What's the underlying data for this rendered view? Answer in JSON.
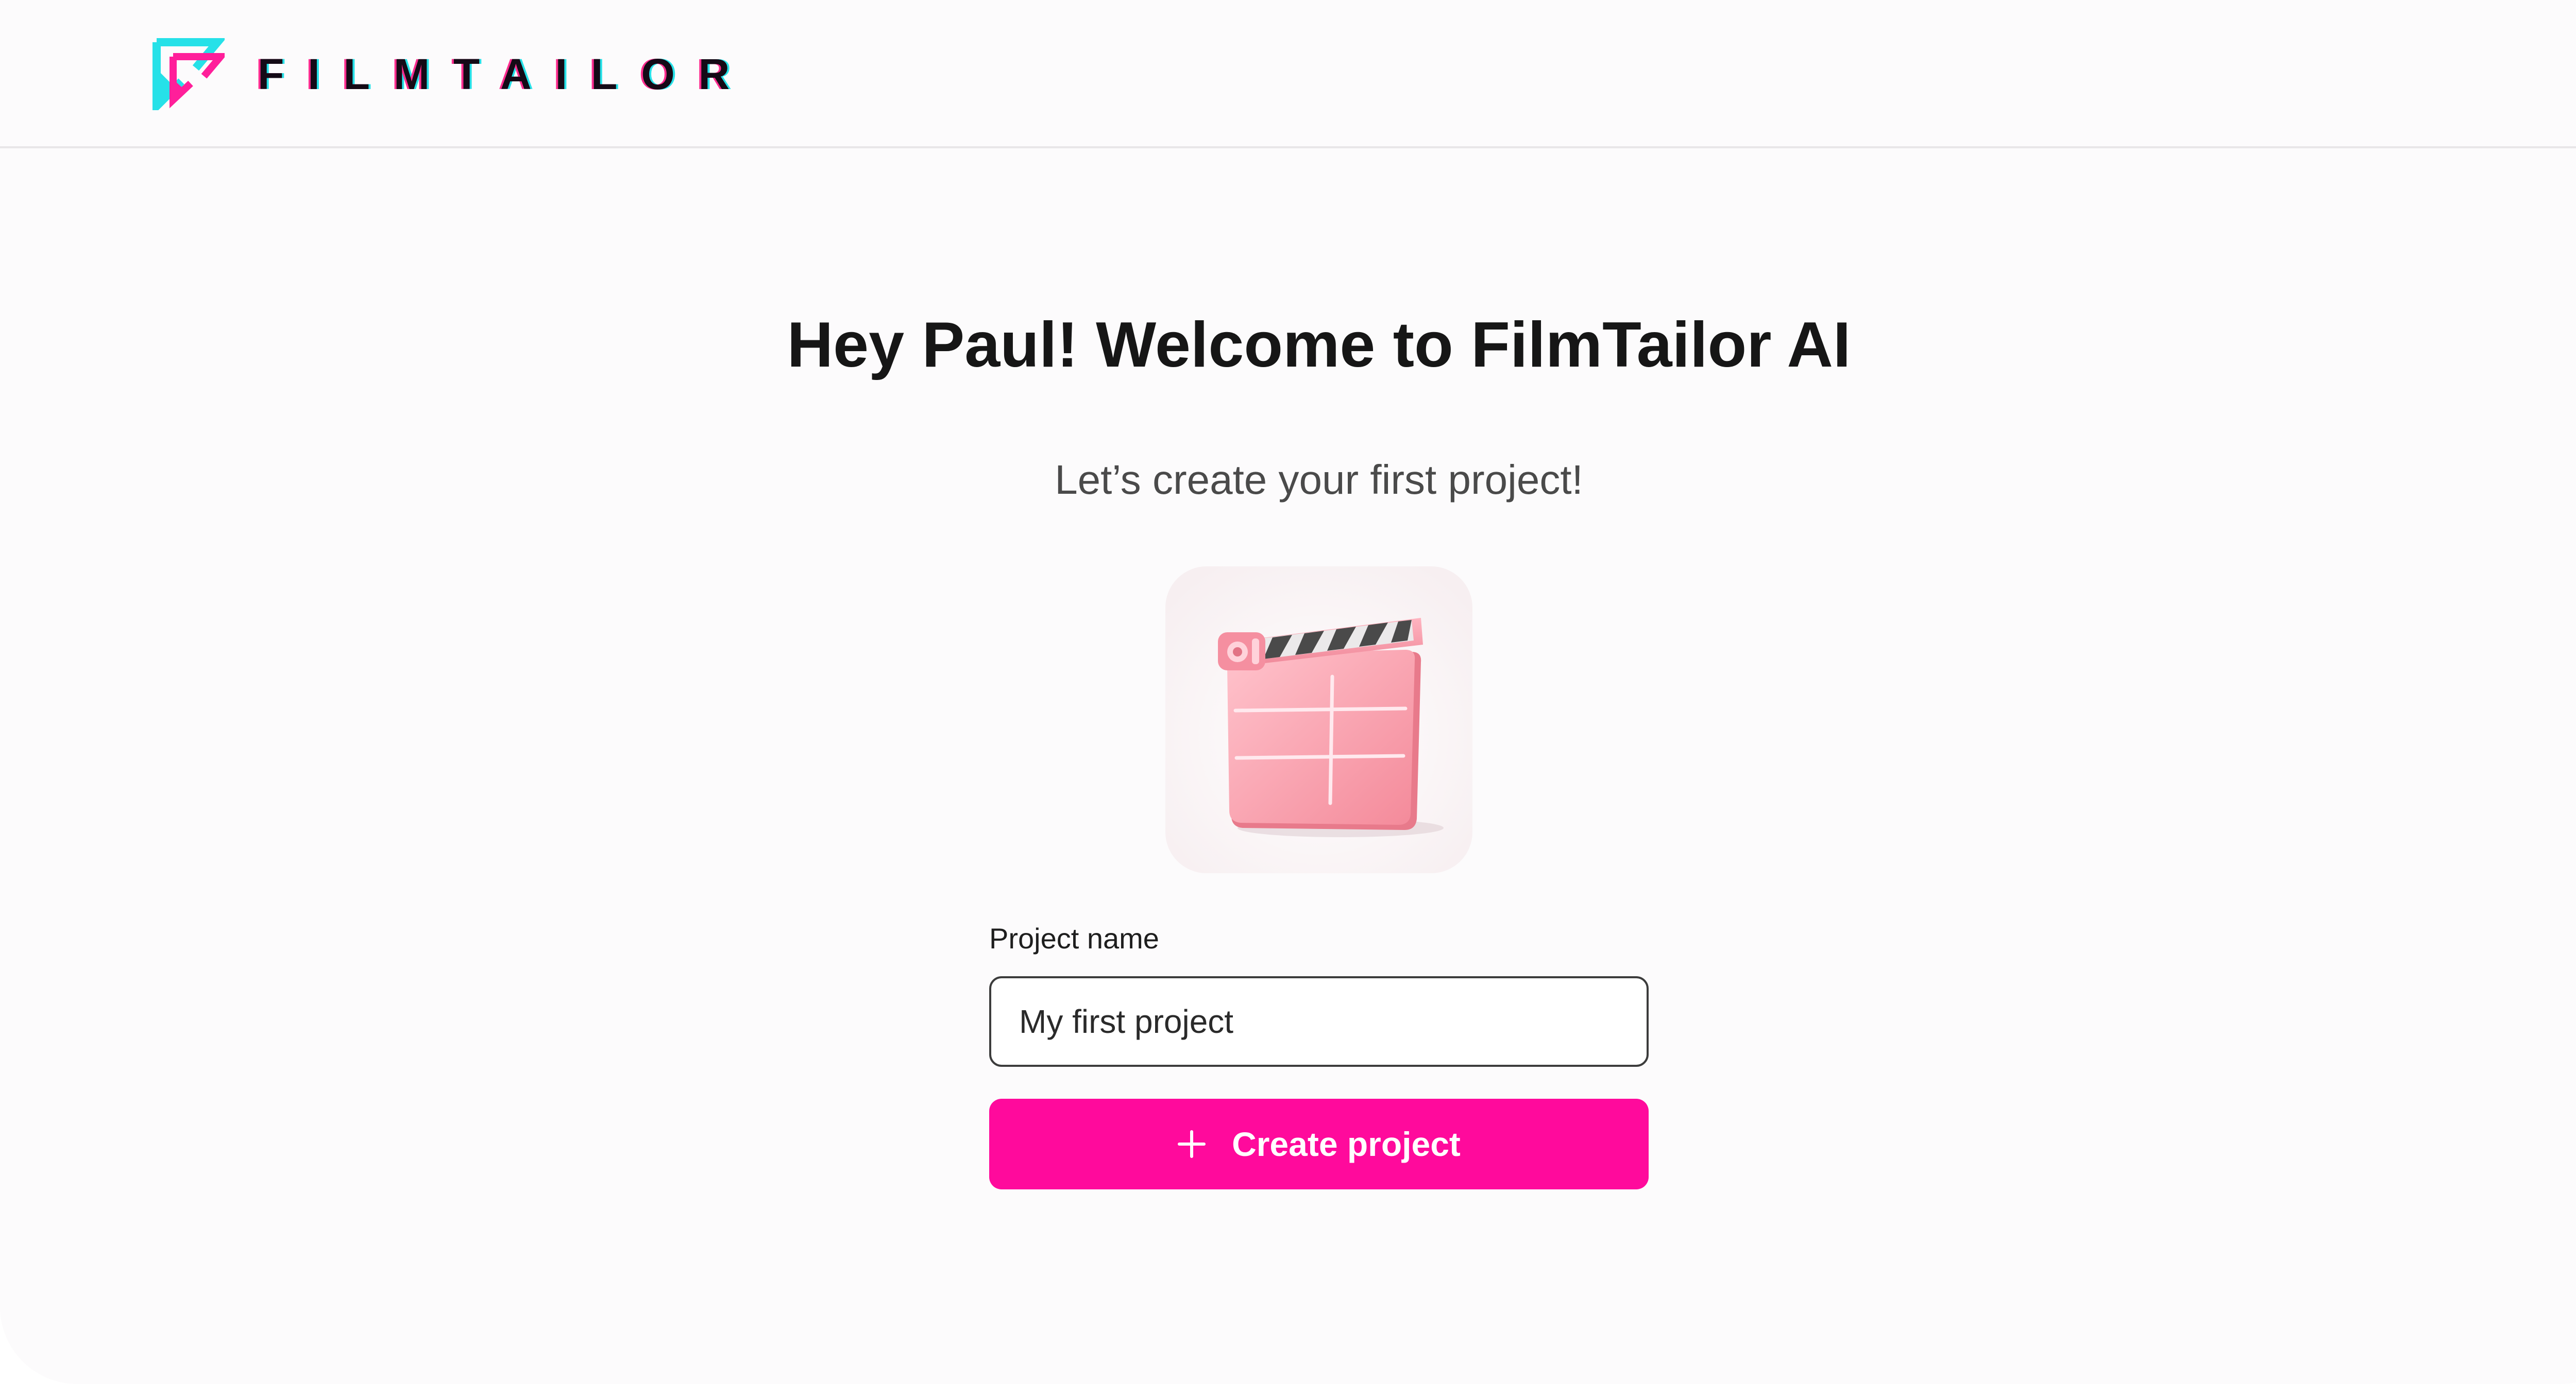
{
  "header": {
    "brand_name": "FILMTAILOR",
    "logo_icon": "filmtailor-logo-icon"
  },
  "main": {
    "title": "Hey Paul! Welcome to FilmTailor AI",
    "subtitle": "Let’s create your first project!",
    "illustration_icon": "clapperboard-icon"
  },
  "form": {
    "project_name_label": "Project name",
    "project_name_value": "My first project",
    "create_button_label": "Create project",
    "create_button_icon": "plus-icon"
  },
  "colors": {
    "accent": "#ff0a9c",
    "logo_cyan": "#26e1e8",
    "logo_pink": "#ff2d8f",
    "background": "#fcfbfc",
    "text_dark": "#161616"
  }
}
